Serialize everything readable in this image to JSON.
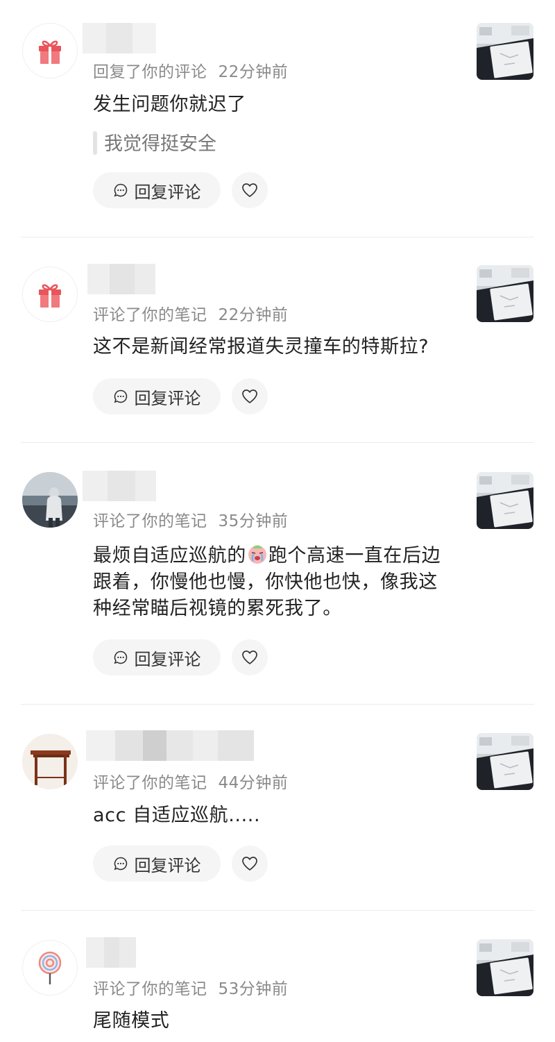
{
  "comments": [
    {
      "action": "回复了你的评论",
      "time": "22分钟前",
      "text": "发生问题你就迟了",
      "quote": "我觉得挺安全",
      "avatar_icon": "gift-icon"
    },
    {
      "action": "评论了你的笔记",
      "time": "22分钟前",
      "text": "这不是新闻经常报道失灵撞车的特斯拉?",
      "avatar_icon": "gift-icon"
    },
    {
      "action": "评论了你的笔记",
      "time": "35分钟前",
      "text_before_emoji": "最烦自适应巡航的",
      "emoji": "crying-face-emoji",
      "text_after_emoji": "跑个高速一直在后边跟着，你慢他也慢，你快他也快，像我这种经常瞄后视镜的累死我了。",
      "avatar_icon": "person-by-sea-photo"
    },
    {
      "action": "评论了你的笔记",
      "time": "44分钟前",
      "text": "acc 自适应巡航.....",
      "avatar_icon": "wooden-table-photo"
    },
    {
      "action": "评论了你的笔记",
      "time": "53分钟前",
      "text": "尾随模式",
      "avatar_icon": "lollipop-icon"
    }
  ],
  "reply_label": "回复评论",
  "like_icon": "heart-icon",
  "thumbnail": "car-dashboard-screen-photo"
}
